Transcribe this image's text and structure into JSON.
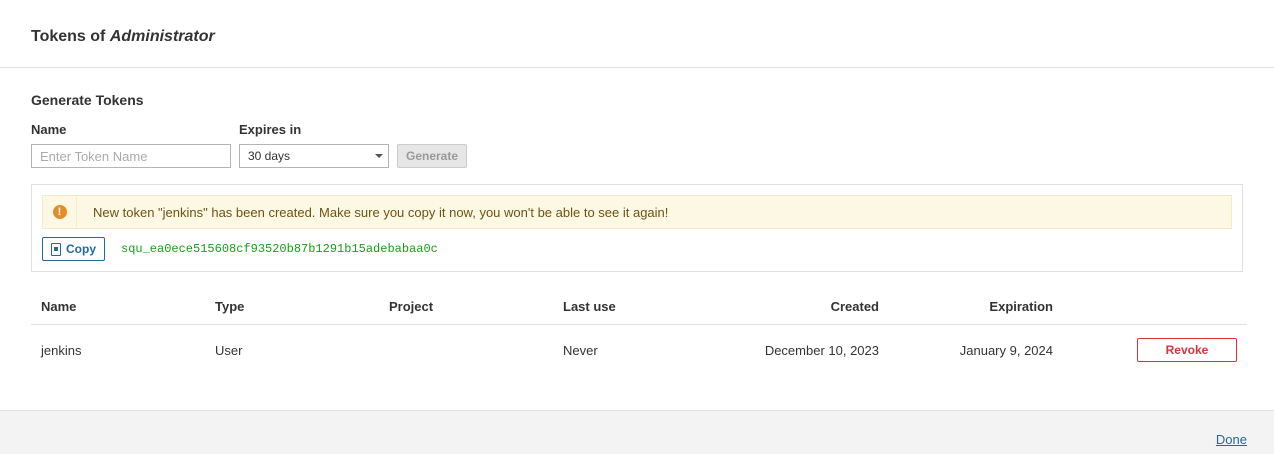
{
  "modal": {
    "title_prefix": "Tokens of",
    "title_user": "Administrator"
  },
  "generate": {
    "section_title": "Generate Tokens",
    "name_label": "Name",
    "name_placeholder": "Enter Token Name",
    "name_value": "",
    "expires_label": "Expires in",
    "expires_value": "30 days",
    "generate_button": "Generate"
  },
  "alert": {
    "icon": "exclamation-circle-icon",
    "message": "New token \"jenkins\" has been created. Make sure you copy it now, you won't be able to see it again!",
    "copy_button": "Copy",
    "token": "squ_ea0ece515608cf93520b87b1291b15adebabaa0c"
  },
  "table": {
    "headers": {
      "name": "Name",
      "type": "Type",
      "project": "Project",
      "last_use": "Last use",
      "created": "Created",
      "expiration": "Expiration"
    },
    "rows": [
      {
        "name": "jenkins",
        "type": "User",
        "project": "",
        "last_use": "Never",
        "created": "December 10, 2023",
        "expiration": "January 9, 2024",
        "action": "Revoke"
      }
    ]
  },
  "footer": {
    "done_link": "Done"
  },
  "colors": {
    "link": "#236a97",
    "danger": "#d4333f",
    "token_text": "#15a015",
    "alert_bg": "#fcf8e3",
    "warning_icon": "#e08d2b"
  }
}
